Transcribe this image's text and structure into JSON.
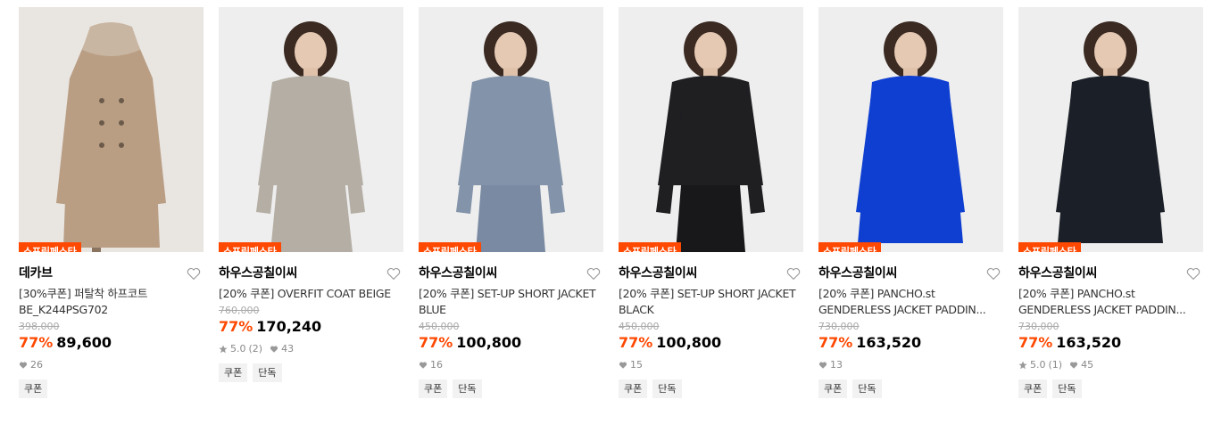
{
  "products": [
    {
      "badge": "스프링페스타",
      "brand": "데카브",
      "title": "[30%쿠폰] 퍼탈착 하프코트 BE_K244PSG702",
      "original_price": "398,000",
      "discount": "77%",
      "price": "89,600",
      "rating": "",
      "reviews": "",
      "likes": "26",
      "tags": [
        "쿠폰"
      ],
      "bg": "#e9e6e2",
      "garment": "#b99e84"
    },
    {
      "badge": "스프링페스타",
      "brand": "하우스공칠이씨",
      "title": "[20% 쿠폰] OVERFIT COAT BEIGE",
      "original_price": "760,000",
      "discount": "77%",
      "price": "170,240",
      "rating": "5.0",
      "reviews": "(2)",
      "likes": "43",
      "tags": [
        "쿠폰",
        "단독"
      ],
      "bg": "#eeeeee",
      "garment": "#b5aea4"
    },
    {
      "badge": "스프링페스타",
      "brand": "하우스공칠이씨",
      "title": "[20% 쿠폰] SET-UP SHORT JACKET BLUE",
      "original_price": "450,000",
      "discount": "77%",
      "price": "100,800",
      "rating": "",
      "reviews": "",
      "likes": "16",
      "tags": [
        "쿠폰",
        "단독"
      ],
      "bg": "#eeeeee",
      "garment": "#8393a9"
    },
    {
      "badge": "스프링페스타",
      "brand": "하우스공칠이씨",
      "title": "[20% 쿠폰] SET-UP SHORT JACKET BLACK",
      "original_price": "450,000",
      "discount": "77%",
      "price": "100,800",
      "rating": "",
      "reviews": "",
      "likes": "15",
      "tags": [
        "쿠폰",
        "단독"
      ],
      "bg": "#eeeeee",
      "garment": "#1f1f22"
    },
    {
      "badge": "스프링페스타",
      "brand": "하우스공칠이씨",
      "title": "[20% 쿠폰] PANCHO.st GENDERLESS JACKET PADDIN...",
      "original_price": "730,000",
      "discount": "77%",
      "price": "163,520",
      "rating": "",
      "reviews": "",
      "likes": "13",
      "tags": [
        "쿠폰",
        "단독"
      ],
      "bg": "#eeeeee",
      "garment": "#0f3fd1"
    },
    {
      "badge": "스프링페스타",
      "brand": "하우스공칠이씨",
      "title": "[20% 쿠폰] PANCHO.st GENDERLESS JACKET PADDIN...",
      "original_price": "730,000",
      "discount": "77%",
      "price": "163,520",
      "rating": "5.0",
      "reviews": "(1)",
      "likes": "45",
      "tags": [
        "쿠폰",
        "단독"
      ],
      "bg": "#eeeeee",
      "garment": "#1b2028"
    }
  ],
  "colors": {
    "accent": "#ff4800",
    "muted": "#aaaaaa",
    "tag_bg": "#f2f2f2"
  }
}
